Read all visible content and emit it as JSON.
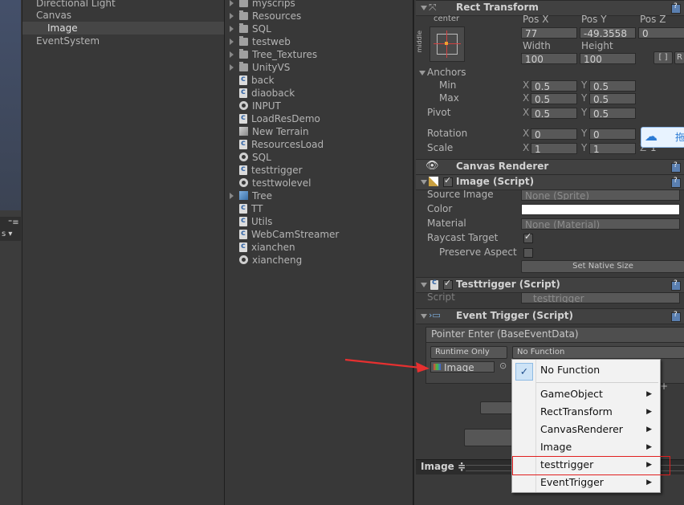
{
  "hierarchy": {
    "items": [
      {
        "label": "Directional Light",
        "indent": 0
      },
      {
        "label": "Canvas",
        "indent": 0
      },
      {
        "label": "Image",
        "indent": 1,
        "selected": true
      },
      {
        "label": "EventSystem",
        "indent": 0
      }
    ]
  },
  "scene_toolbar": {
    "glyph1": "⁼≡",
    "glyph2": "s ▾"
  },
  "project": {
    "items": [
      {
        "label": "myscrips",
        "icon": "folder-icon",
        "folder": true
      },
      {
        "label": "Resources",
        "icon": "folder-icon",
        "folder": true
      },
      {
        "label": "SQL",
        "icon": "folder-icon",
        "folder": true
      },
      {
        "label": "testweb",
        "icon": "folder-icon",
        "folder": true
      },
      {
        "label": "Tree_Textures",
        "icon": "folder-icon",
        "folder": true
      },
      {
        "label": "UnityVS",
        "icon": "folder-icon",
        "folder": true
      },
      {
        "label": "back",
        "icon": "csharp-script-icon"
      },
      {
        "label": "diaoback",
        "icon": "csharp-script-icon"
      },
      {
        "label": "INPUT",
        "icon": "unity-scene-icon"
      },
      {
        "label": "LoadResDemo",
        "icon": "csharp-script-icon"
      },
      {
        "label": "New Terrain",
        "icon": "terrain-prefab-icon"
      },
      {
        "label": "ResourcesLoad",
        "icon": "csharp-script-icon"
      },
      {
        "label": "SQL",
        "icon": "unity-scene-icon"
      },
      {
        "label": "testtrigger",
        "icon": "csharp-script-icon"
      },
      {
        "label": "testtwolevel",
        "icon": "unity-scene-icon"
      },
      {
        "label": "Tree",
        "icon": "tree-prefab-icon",
        "folder": true
      },
      {
        "label": "TT",
        "icon": "csharp-script-icon"
      },
      {
        "label": "Utils",
        "icon": "csharp-script-icon"
      },
      {
        "label": "WebCamStreamer",
        "icon": "csharp-script-icon"
      },
      {
        "label": "xianchen",
        "icon": "csharp-script-icon"
      },
      {
        "label": "xiancheng",
        "icon": "unity-scene-icon"
      }
    ]
  },
  "rect_transform": {
    "title": "Rect Transform",
    "anchor_label": "center",
    "side_label": "middle",
    "pos_x_label": "Pos X",
    "pos_y_label": "Pos Y",
    "pos_z_label": "Pos Z",
    "pos_x": "77",
    "pos_y": "-49.3558",
    "pos_z": "0",
    "width_label": "Width",
    "height_label": "Height",
    "width": "100",
    "height": "100",
    "blueprint_btn": "[ ]",
    "r_btn": "R",
    "anchors_label": "Anchors",
    "min_label": "Min",
    "max_label": "Max",
    "min_x": "0.5",
    "min_y": "0.5",
    "max_x": "0.5",
    "max_y": "0.5",
    "pivot_label": "Pivot",
    "pivot_x": "0.5",
    "pivot_y": "0.5",
    "rotation_label": "Rotation",
    "rot_x": "0",
    "rot_y": "0",
    "scale_label": "Scale",
    "scale_x": "1",
    "scale_y": "1",
    "scale_z": "1",
    "x_axis": "X",
    "y_axis": "Y",
    "z_axis": "Z"
  },
  "baidu_badge": {
    "text": "拖"
  },
  "canvas_renderer": {
    "title": "Canvas Renderer"
  },
  "image_script": {
    "title": "Image (Script)",
    "source_image_label": "Source Image",
    "source_image": "None (Sprite)",
    "color_label": "Color",
    "color_value": "#ffffff",
    "material_label": "Material",
    "material": "None (Material)",
    "raycast_label": "Raycast Target",
    "raycast_checked": true,
    "preserve_label": "Preserve Aspect",
    "preserve_checked": false,
    "native_size_btn": "Set Native Size"
  },
  "testtrigger_script": {
    "title": "Testtrigger (Script)",
    "script_label": "Script",
    "script_value": "testtrigger"
  },
  "event_trigger": {
    "title": "Event Trigger (Script)",
    "entry_header": "Pointer Enter (BaseEventData)",
    "runtime": "Runtime Only",
    "function": "No Function",
    "target": "Image",
    "plus_minus": "+"
  },
  "func_menu": {
    "items": [
      {
        "label": "No Function",
        "checked": true,
        "submenu": false
      },
      {
        "label": "GameObject",
        "submenu": true
      },
      {
        "label": "RectTransform",
        "submenu": true
      },
      {
        "label": "CanvasRenderer",
        "submenu": true
      },
      {
        "label": "Image",
        "submenu": true
      },
      {
        "label": "testtrigger",
        "submenu": true,
        "highlighted": true
      },
      {
        "label": "EventTrigger",
        "submenu": true
      }
    ],
    "submenu_arrow": "▶",
    "check_glyph": "✓"
  },
  "preview_bar": {
    "label": "Image ≑"
  },
  "colors": {
    "highlight_box": "#e02020",
    "arrow": "#e63030",
    "help_icon": "#5a7fb0"
  }
}
